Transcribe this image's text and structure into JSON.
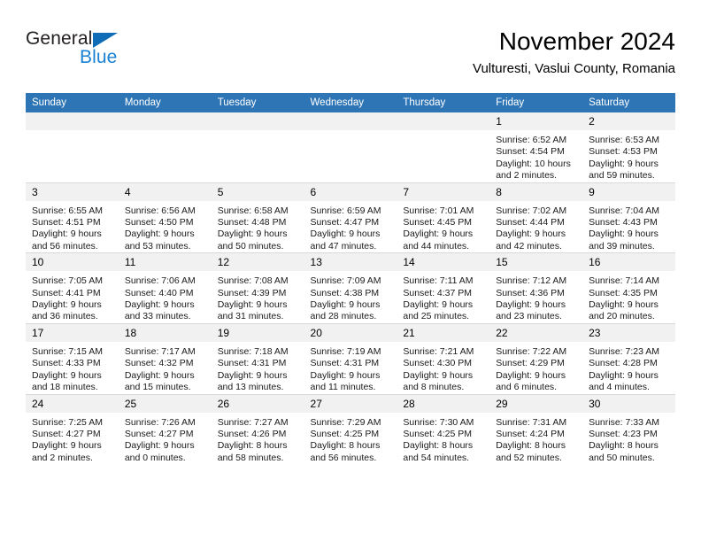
{
  "brand": {
    "name_part1": "General",
    "name_part2": "Blue",
    "triangle_color": "#0f6cb6",
    "blue_text_color": "#1b81d3"
  },
  "header": {
    "month_title": "November 2024",
    "location": "Vulturesti, Vaslui County, Romania"
  },
  "theme": {
    "header_bg": "#2e75b6",
    "daynum_bg": "#f1f1f1",
    "grid_line": "#d9d9d9",
    "body_bg": "#ffffff"
  },
  "weekdays": [
    "Sunday",
    "Monday",
    "Tuesday",
    "Wednesday",
    "Thursday",
    "Friday",
    "Saturday"
  ],
  "weeks": [
    [
      {
        "day": "",
        "blank": true,
        "sunrise": "",
        "sunset": "",
        "daylight1": "",
        "daylight2": ""
      },
      {
        "day": "",
        "blank": true,
        "sunrise": "",
        "sunset": "",
        "daylight1": "",
        "daylight2": ""
      },
      {
        "day": "",
        "blank": true,
        "sunrise": "",
        "sunset": "",
        "daylight1": "",
        "daylight2": ""
      },
      {
        "day": "",
        "blank": true,
        "sunrise": "",
        "sunset": "",
        "daylight1": "",
        "daylight2": ""
      },
      {
        "day": "",
        "blank": true,
        "sunrise": "",
        "sunset": "",
        "daylight1": "",
        "daylight2": ""
      },
      {
        "day": "1",
        "blank": false,
        "sunrise": "Sunrise: 6:52 AM",
        "sunset": "Sunset: 4:54 PM",
        "daylight1": "Daylight: 10 hours",
        "daylight2": "and 2 minutes."
      },
      {
        "day": "2",
        "blank": false,
        "sunrise": "Sunrise: 6:53 AM",
        "sunset": "Sunset: 4:53 PM",
        "daylight1": "Daylight: 9 hours",
        "daylight2": "and 59 minutes."
      }
    ],
    [
      {
        "day": "3",
        "blank": false,
        "sunrise": "Sunrise: 6:55 AM",
        "sunset": "Sunset: 4:51 PM",
        "daylight1": "Daylight: 9 hours",
        "daylight2": "and 56 minutes."
      },
      {
        "day": "4",
        "blank": false,
        "sunrise": "Sunrise: 6:56 AM",
        "sunset": "Sunset: 4:50 PM",
        "daylight1": "Daylight: 9 hours",
        "daylight2": "and 53 minutes."
      },
      {
        "day": "5",
        "blank": false,
        "sunrise": "Sunrise: 6:58 AM",
        "sunset": "Sunset: 4:48 PM",
        "daylight1": "Daylight: 9 hours",
        "daylight2": "and 50 minutes."
      },
      {
        "day": "6",
        "blank": false,
        "sunrise": "Sunrise: 6:59 AM",
        "sunset": "Sunset: 4:47 PM",
        "daylight1": "Daylight: 9 hours",
        "daylight2": "and 47 minutes."
      },
      {
        "day": "7",
        "blank": false,
        "sunrise": "Sunrise: 7:01 AM",
        "sunset": "Sunset: 4:45 PM",
        "daylight1": "Daylight: 9 hours",
        "daylight2": "and 44 minutes."
      },
      {
        "day": "8",
        "blank": false,
        "sunrise": "Sunrise: 7:02 AM",
        "sunset": "Sunset: 4:44 PM",
        "daylight1": "Daylight: 9 hours",
        "daylight2": "and 42 minutes."
      },
      {
        "day": "9",
        "blank": false,
        "sunrise": "Sunrise: 7:04 AM",
        "sunset": "Sunset: 4:43 PM",
        "daylight1": "Daylight: 9 hours",
        "daylight2": "and 39 minutes."
      }
    ],
    [
      {
        "day": "10",
        "blank": false,
        "sunrise": "Sunrise: 7:05 AM",
        "sunset": "Sunset: 4:41 PM",
        "daylight1": "Daylight: 9 hours",
        "daylight2": "and 36 minutes."
      },
      {
        "day": "11",
        "blank": false,
        "sunrise": "Sunrise: 7:06 AM",
        "sunset": "Sunset: 4:40 PM",
        "daylight1": "Daylight: 9 hours",
        "daylight2": "and 33 minutes."
      },
      {
        "day": "12",
        "blank": false,
        "sunrise": "Sunrise: 7:08 AM",
        "sunset": "Sunset: 4:39 PM",
        "daylight1": "Daylight: 9 hours",
        "daylight2": "and 31 minutes."
      },
      {
        "day": "13",
        "blank": false,
        "sunrise": "Sunrise: 7:09 AM",
        "sunset": "Sunset: 4:38 PM",
        "daylight1": "Daylight: 9 hours",
        "daylight2": "and 28 minutes."
      },
      {
        "day": "14",
        "blank": false,
        "sunrise": "Sunrise: 7:11 AM",
        "sunset": "Sunset: 4:37 PM",
        "daylight1": "Daylight: 9 hours",
        "daylight2": "and 25 minutes."
      },
      {
        "day": "15",
        "blank": false,
        "sunrise": "Sunrise: 7:12 AM",
        "sunset": "Sunset: 4:36 PM",
        "daylight1": "Daylight: 9 hours",
        "daylight2": "and 23 minutes."
      },
      {
        "day": "16",
        "blank": false,
        "sunrise": "Sunrise: 7:14 AM",
        "sunset": "Sunset: 4:35 PM",
        "daylight1": "Daylight: 9 hours",
        "daylight2": "and 20 minutes."
      }
    ],
    [
      {
        "day": "17",
        "blank": false,
        "sunrise": "Sunrise: 7:15 AM",
        "sunset": "Sunset: 4:33 PM",
        "daylight1": "Daylight: 9 hours",
        "daylight2": "and 18 minutes."
      },
      {
        "day": "18",
        "blank": false,
        "sunrise": "Sunrise: 7:17 AM",
        "sunset": "Sunset: 4:32 PM",
        "daylight1": "Daylight: 9 hours",
        "daylight2": "and 15 minutes."
      },
      {
        "day": "19",
        "blank": false,
        "sunrise": "Sunrise: 7:18 AM",
        "sunset": "Sunset: 4:31 PM",
        "daylight1": "Daylight: 9 hours",
        "daylight2": "and 13 minutes."
      },
      {
        "day": "20",
        "blank": false,
        "sunrise": "Sunrise: 7:19 AM",
        "sunset": "Sunset: 4:31 PM",
        "daylight1": "Daylight: 9 hours",
        "daylight2": "and 11 minutes."
      },
      {
        "day": "21",
        "blank": false,
        "sunrise": "Sunrise: 7:21 AM",
        "sunset": "Sunset: 4:30 PM",
        "daylight1": "Daylight: 9 hours",
        "daylight2": "and 8 minutes."
      },
      {
        "day": "22",
        "blank": false,
        "sunrise": "Sunrise: 7:22 AM",
        "sunset": "Sunset: 4:29 PM",
        "daylight1": "Daylight: 9 hours",
        "daylight2": "and 6 minutes."
      },
      {
        "day": "23",
        "blank": false,
        "sunrise": "Sunrise: 7:23 AM",
        "sunset": "Sunset: 4:28 PM",
        "daylight1": "Daylight: 9 hours",
        "daylight2": "and 4 minutes."
      }
    ],
    [
      {
        "day": "24",
        "blank": false,
        "sunrise": "Sunrise: 7:25 AM",
        "sunset": "Sunset: 4:27 PM",
        "daylight1": "Daylight: 9 hours",
        "daylight2": "and 2 minutes."
      },
      {
        "day": "25",
        "blank": false,
        "sunrise": "Sunrise: 7:26 AM",
        "sunset": "Sunset: 4:27 PM",
        "daylight1": "Daylight: 9 hours",
        "daylight2": "and 0 minutes."
      },
      {
        "day": "26",
        "blank": false,
        "sunrise": "Sunrise: 7:27 AM",
        "sunset": "Sunset: 4:26 PM",
        "daylight1": "Daylight: 8 hours",
        "daylight2": "and 58 minutes."
      },
      {
        "day": "27",
        "blank": false,
        "sunrise": "Sunrise: 7:29 AM",
        "sunset": "Sunset: 4:25 PM",
        "daylight1": "Daylight: 8 hours",
        "daylight2": "and 56 minutes."
      },
      {
        "day": "28",
        "blank": false,
        "sunrise": "Sunrise: 7:30 AM",
        "sunset": "Sunset: 4:25 PM",
        "daylight1": "Daylight: 8 hours",
        "daylight2": "and 54 minutes."
      },
      {
        "day": "29",
        "blank": false,
        "sunrise": "Sunrise: 7:31 AM",
        "sunset": "Sunset: 4:24 PM",
        "daylight1": "Daylight: 8 hours",
        "daylight2": "and 52 minutes."
      },
      {
        "day": "30",
        "blank": false,
        "sunrise": "Sunrise: 7:33 AM",
        "sunset": "Sunset: 4:23 PM",
        "daylight1": "Daylight: 8 hours",
        "daylight2": "and 50 minutes."
      }
    ]
  ]
}
